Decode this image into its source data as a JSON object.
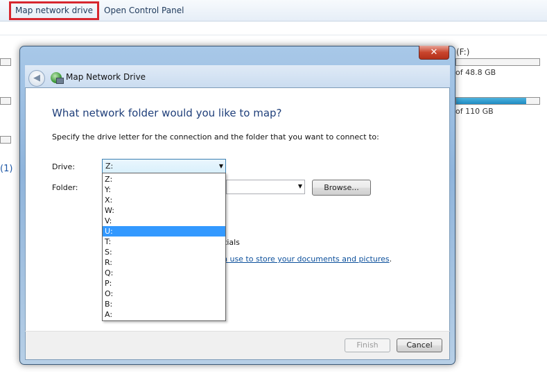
{
  "toolbar": {
    "map_network_drive": "Map network drive",
    "open_control_panel": "Open Control Panel"
  },
  "background": {
    "drive_label_f": "(F:)",
    "drive_f_size": "of 48.8 GB",
    "drive_g_size": "of 110 GB",
    "left_count": "(1)"
  },
  "dialog": {
    "title": "Map Network Drive",
    "heading": "What network folder would you like to map?",
    "instructions": "Specify the drive letter for the connection and the folder that you want to connect to:",
    "drive_label": "Drive:",
    "folder_label": "Folder:",
    "drive_value": "Z:",
    "browse_label": "Browse...",
    "credentials_fragment": "tials",
    "link_fragment": "n use to store your documents and pictures",
    "link_period": ".",
    "finish_label": "Finish",
    "cancel_label": "Cancel",
    "close_glyph": "✕",
    "back_glyph": "◀"
  },
  "drive_options": [
    "Z:",
    "Y:",
    "X:",
    "W:",
    "V:",
    "U:",
    "T:",
    "S:",
    "R:",
    "Q:",
    "P:",
    "O:",
    "B:",
    "A:"
  ],
  "highlighted_option": "U:",
  "colors": {
    "accent_highlight": "#3399ff",
    "heading": "#1f3f7a",
    "link": "#0b4f9b",
    "toolbar_highlight": "#d7262e"
  }
}
